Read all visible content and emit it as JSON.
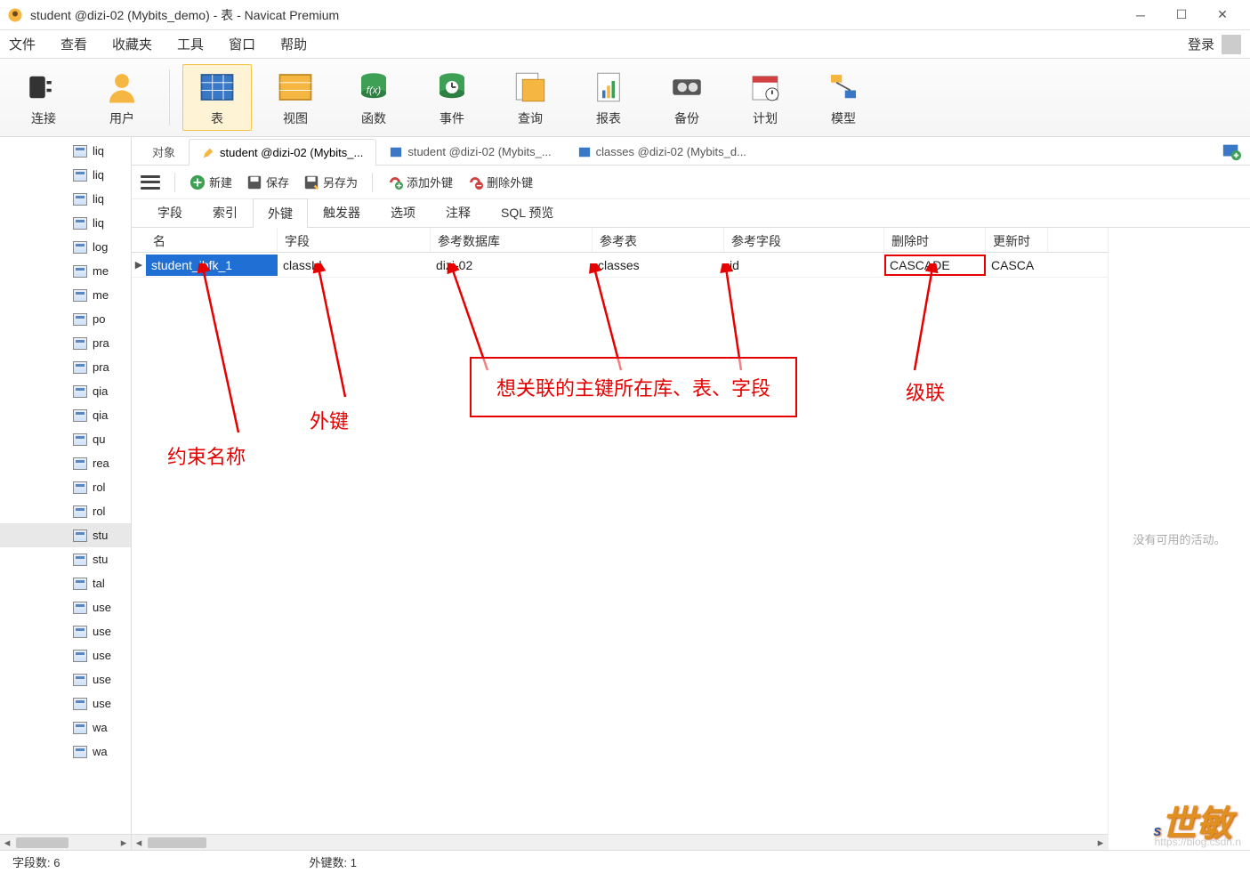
{
  "window": {
    "title": "student @dizi-02 (Mybits_demo) - 表 - Navicat Premium"
  },
  "menu": {
    "file": "文件",
    "view": "查看",
    "fav": "收藏夹",
    "tools": "工具",
    "window": "窗口",
    "help": "帮助",
    "login": "登录"
  },
  "toolbar": {
    "connect": "连接",
    "user": "用户",
    "table": "表",
    "view": "视图",
    "func": "函数",
    "event": "事件",
    "query": "查询",
    "report": "报表",
    "backup": "备份",
    "plan": "计划",
    "model": "模型"
  },
  "sidebar": {
    "items": [
      "liq",
      "liq",
      "liq",
      "liq",
      "log",
      "me",
      "me",
      "po",
      "pra",
      "pra",
      "qia",
      "qia",
      "qu",
      "rea",
      "rol",
      "rol",
      "stu",
      "stu",
      "tal",
      "use",
      "use",
      "use",
      "use",
      "use",
      "wa",
      "wa"
    ],
    "selected_index": 16
  },
  "tabs": {
    "objects": "对象",
    "items": [
      {
        "label": "student @dizi-02 (Mybits_...",
        "active": true
      },
      {
        "label": "student @dizi-02 (Mybits_...",
        "active": false
      },
      {
        "label": "classes @dizi-02 (Mybits_d...",
        "active": false
      }
    ]
  },
  "actions": {
    "new": "新建",
    "save": "保存",
    "saveas": "另存为",
    "addfk": "添加外键",
    "delfk": "删除外键"
  },
  "subtabs": {
    "field": "字段",
    "index": "索引",
    "fk": "外键",
    "trigger": "触发器",
    "option": "选项",
    "comment": "注释",
    "sql": "SQL 预览",
    "active": "fk"
  },
  "grid": {
    "headers": {
      "name": "名",
      "field": "字段",
      "db": "参考数据库",
      "table": "参考表",
      "reffield": "参考字段",
      "ondel": "删除时",
      "onupd": "更新时"
    },
    "rows": [
      {
        "name": "student_ibfk_1",
        "field": "classId",
        "db": "dizi-02",
        "table": "classes",
        "reffield": "id",
        "ondel": "CASCADE",
        "onupd": "CASCA"
      }
    ]
  },
  "right_pane": {
    "empty_text": "没有可用的活动。"
  },
  "annotations": {
    "constraint_name": "约束名称",
    "foreign_key": "外键",
    "ref_box": "想关联的主键所在库、表、字段",
    "cascade": "级联"
  },
  "status": {
    "fields": "字段数: 6",
    "fks": "外键数: 1"
  },
  "watermark": {
    "url": "https://blog.csdn.n"
  }
}
